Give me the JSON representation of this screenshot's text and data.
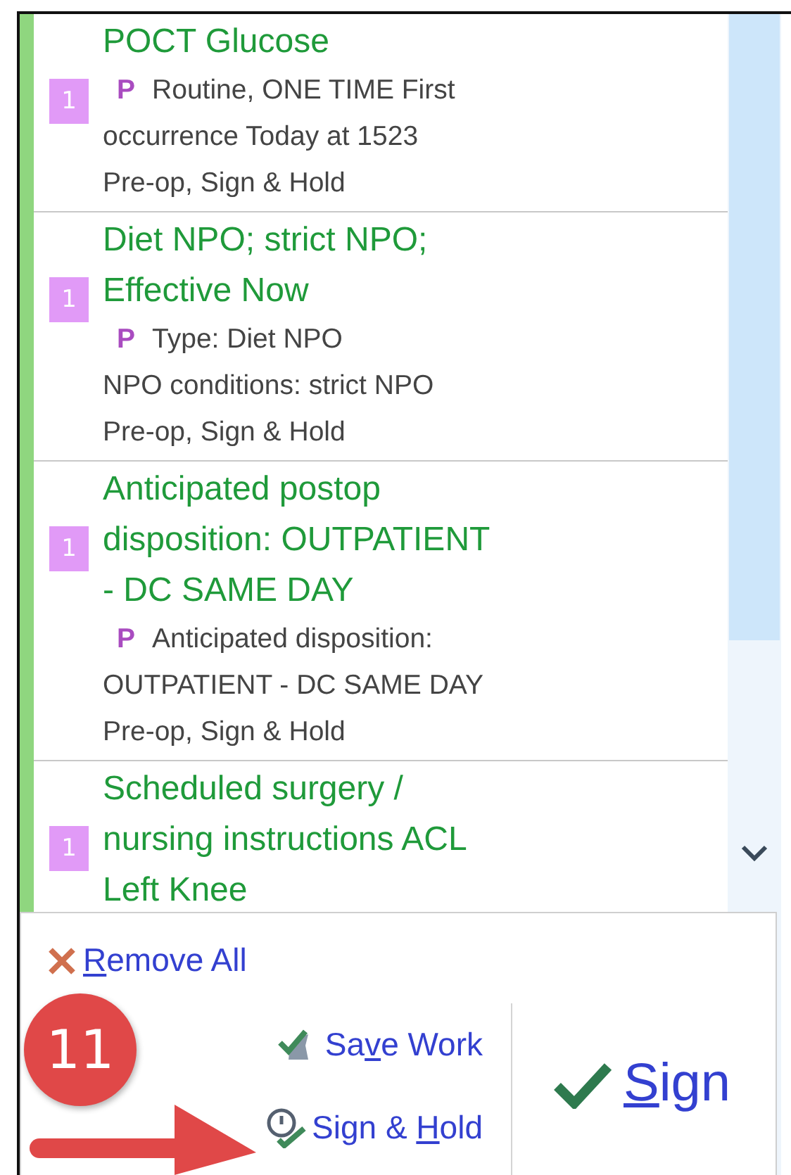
{
  "orders": [
    {
      "badge": "1",
      "title_lines": [
        "POCT Glucose"
      ],
      "priority": "P",
      "detail_lines": [
        "Routine, ONE TIME First",
        "occurrence Today at 1523",
        "Pre-op, Sign & Hold"
      ]
    },
    {
      "badge": "1",
      "title_lines": [
        "Diet NPO; strict NPO;",
        "Effective Now"
      ],
      "priority": "P",
      "detail_lines": [
        "Type: Diet NPO",
        "NPO conditions: strict NPO",
        "Pre-op, Sign & Hold"
      ]
    },
    {
      "badge": "1",
      "title_lines": [
        "Anticipated postop",
        "disposition: OUTPATIENT",
        "- DC SAME DAY"
      ],
      "priority": "P",
      "detail_lines": [
        "Anticipated disposition:",
        "OUTPATIENT - DC SAME DAY",
        "Pre-op, Sign & Hold"
      ]
    },
    {
      "badge": "1",
      "title_lines": [
        "Scheduled surgery /",
        "nursing instructions ACL",
        "Left Knee"
      ]
    }
  ],
  "actions": {
    "remove_all": {
      "parts": [
        {
          "text": "R",
          "underlined": true
        },
        {
          "text": "emove All",
          "underlined": false
        }
      ]
    },
    "save_work": {
      "parts": [
        {
          "text": "Sa",
          "underlined": false
        },
        {
          "text": "v",
          "underlined": true
        },
        {
          "text": "e Work",
          "underlined": false
        }
      ]
    },
    "sign_hold": {
      "parts": [
        {
          "text": "Sign & ",
          "underlined": false
        },
        {
          "text": "H",
          "underlined": true
        },
        {
          "text": "old",
          "underlined": false
        }
      ]
    },
    "sign": {
      "parts": [
        {
          "text": "S",
          "underlined": true
        },
        {
          "text": "ign",
          "underlined": false
        }
      ]
    }
  },
  "callout": {
    "number": "11"
  }
}
